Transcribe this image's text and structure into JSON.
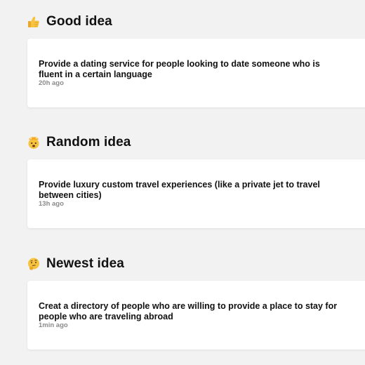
{
  "sections": [
    {
      "title": "Good idea",
      "emoji": "thumbs-up-icon",
      "idea": {
        "text": "Provide a dating service for people looking to date someone who is fluent in a certain language",
        "time": "20h ago"
      }
    },
    {
      "title": "Random idea",
      "emoji": "exploding-head-icon",
      "idea": {
        "text": "Provide luxury custom travel experiences (like a private jet to travel between cities)",
        "time": "13h ago"
      }
    },
    {
      "title": "Newest idea",
      "emoji": "thinking-face-icon",
      "idea": {
        "text": "Creat a directory of people who are willing to provide a place to stay for people who are traveling abroad",
        "time": "1min ago"
      }
    }
  ],
  "colors": {
    "background": "#f2f2f2",
    "card": "#ffffff",
    "text": "#111111",
    "muted": "#8a8a8a",
    "emoji_yellow": "#f7c23e"
  }
}
